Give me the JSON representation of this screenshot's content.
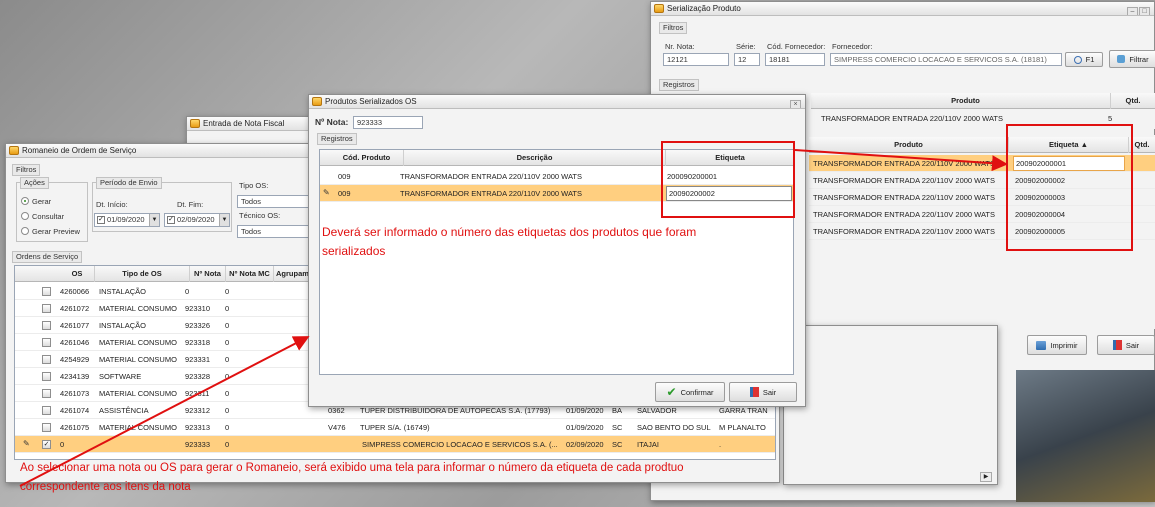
{
  "serializacao": {
    "title": "Serialização Produto",
    "filtros_label": "Filtros",
    "nr_nota_label": "Nr. Nota:",
    "nr_nota_value": "12121",
    "serie_label": "Série:",
    "serie_value": "12",
    "cod_fornecedor_label": "Cód. Fornecedor:",
    "cod_fornecedor_value": "18181",
    "fornecedor_label": "Fornecedor:",
    "fornecedor_value": "SIMPRESS COMERCIO LOCACAO E SERVICOS S.A. (18181)",
    "f1_label": "F1",
    "filtrar_label": "Filtrar",
    "registros_label": "Registros",
    "top_grid": {
      "columns": [
        "Produto",
        "Qtd."
      ],
      "rows": [
        {
          "produto": "TRANSFORMADOR ENTRADA 220/110V 2000 WATS",
          "qtd": "5"
        }
      ]
    },
    "detail_grid": {
      "columns": [
        "Produto",
        "Etiqueta",
        "Qtd."
      ],
      "rows": [
        {
          "produto": "TRANSFORMADOR ENTRADA 220/110V 2000 WATS",
          "etiqueta": "200902000001"
        },
        {
          "produto": "TRANSFORMADOR ENTRADA 220/110V 2000 WATS",
          "etiqueta": "200902000002"
        },
        {
          "produto": "TRANSFORMADOR ENTRADA 220/110V 2000 WATS",
          "etiqueta": "200902000003"
        },
        {
          "produto": "TRANSFORMADOR ENTRADA 220/110V 2000 WATS",
          "etiqueta": "200902000004"
        },
        {
          "produto": "TRANSFORMADOR ENTRADA 220/110V 2000 WATS",
          "etiqueta": "200902000005"
        }
      ]
    },
    "imprimir_label": "Imprimir",
    "sair_label": "Sair"
  },
  "entrada_nf": {
    "title": "Entrada de Nota Fiscal"
  },
  "romaneio": {
    "title": "Romaneio de Ordem de Serviço",
    "filtros_label": "Filtros",
    "acoes_label": "Ações",
    "acoes": [
      "Gerar",
      "Consultar",
      "Gerar Preview"
    ],
    "periodo_label": "Período de Envio",
    "dt_inicio_label": "Dt. Início:",
    "dt_inicio_value": "01/09/2020",
    "dt_fim_label": "Dt. Fim:",
    "dt_fim_value": "02/09/2020",
    "tipo_os_label": "Tipo OS:",
    "tipo_os_value": "Todos",
    "tecnico_os_label": "Técnico OS:",
    "tecnico_os_value": "Todos",
    "ordens_label": "Ordens de Serviço",
    "columns": [
      "OS",
      "Tipo de OS",
      "Nº Nota",
      "Nº Nota MC",
      "Agrupam"
    ],
    "rows": [
      {
        "os": "4260066",
        "tipo": "INSTALAÇÃO",
        "nota": "0",
        "nota_mc": "0"
      },
      {
        "os": "4261072",
        "tipo": "MATERIAL CONSUMO",
        "nota": "923310",
        "nota_mc": "0"
      },
      {
        "os": "4261077",
        "tipo": "INSTALAÇÃO",
        "nota": "923326",
        "nota_mc": "0"
      },
      {
        "os": "4261046",
        "tipo": "MATERIAL CONSUMO",
        "nota": "923318",
        "nota_mc": "0"
      },
      {
        "os": "4254929",
        "tipo": "MATERIAL CONSUMO",
        "nota": "923331",
        "nota_mc": "0"
      },
      {
        "os": "4234139",
        "tipo": "SOFTWARE",
        "nota": "923328",
        "nota_mc": "0"
      },
      {
        "os": "4261073",
        "tipo": "MATERIAL CONSUMO",
        "nota": "923311",
        "nota_mc": "0"
      },
      {
        "os": "4261074",
        "tipo": "ASSISTÊNCIA",
        "nota": "923312",
        "nota_mc": "0",
        "cod": "0362",
        "cliente": "TUPER DISTRIBUIDORA DE AUTOPECAS S.A. (17793)",
        "data": "01/09/2020",
        "uf": "BA",
        "cidade": "SALVADOR",
        "extra": "GARRA TRAN"
      },
      {
        "os": "4261075",
        "tipo": "MATERIAL CONSUMO",
        "nota": "923313",
        "nota_mc": "0",
        "cod": "V476",
        "cliente": "TUPER S/A. (16749)",
        "data": "01/09/2020",
        "uf": "SC",
        "cidade": "SAO BENTO DO SUL",
        "extra": "M PLANALTO"
      },
      {
        "os": "0",
        "tipo": "",
        "nota": "923333",
        "nota_mc": "0",
        "cliente": "SIMPRESS COMERCIO LOCACAO E SERVICOS S.A. (...",
        "data": "02/09/2020",
        "uf": "SC",
        "cidade": "ITAJAI",
        "extra": "."
      }
    ]
  },
  "produtos": {
    "title": "Produtos Serializados OS",
    "nota_label": "Nº Nota:",
    "nota_value": "923333",
    "registros_label": "Registros",
    "columns": [
      "Cód. Produto",
      "Descrição",
      "Etiqueta"
    ],
    "rows": [
      {
        "cod": "009",
        "descricao": "TRANSFORMADOR ENTRADA 220/110V 2000 WATS",
        "etiqueta": "200090200001"
      },
      {
        "cod": "009",
        "descricao": "TRANSFORMADOR ENTRADA 220/110V 2000 WATS",
        "etiqueta": "20090200002"
      }
    ],
    "confirmar_label": "Confirmar",
    "sair_label": "Sair"
  },
  "annotations": {
    "middle_line1": "Deverá ser informado o número das etiquetas dos produtos que foram",
    "middle_line2": "serializados",
    "bottom_line1": "Ao selecionar uma nota ou OS para gerar o Romaneio, será exibido uma tela para informar o número da etiqueta de cada prodtuo",
    "bottom_line2": "correspondente aos itens da nota"
  },
  "colors": {
    "annotation_red": "#e01010",
    "selection": "#ffcf80"
  }
}
